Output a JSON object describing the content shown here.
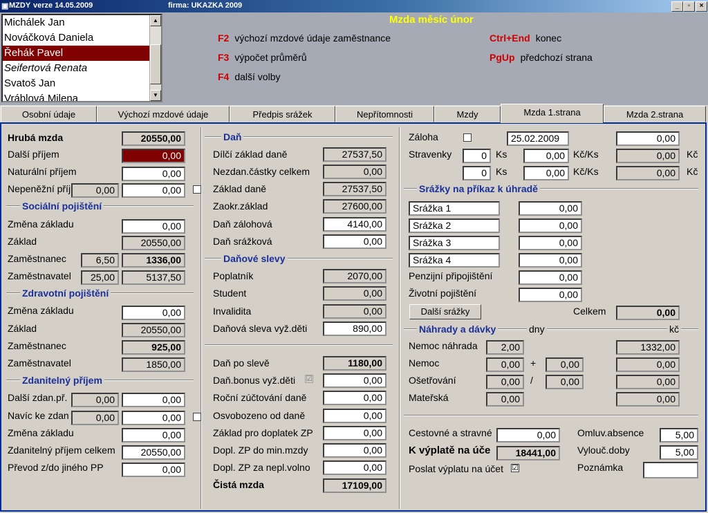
{
  "window": {
    "app": "MZDY",
    "version": "verze 14.05.2009",
    "firm": "firma: UKAZKA 2009",
    "btn_min": "_",
    "btn_max": "▫",
    "btn_close": "×"
  },
  "header": {
    "month": "Mzda měsíc únor",
    "employees": [
      "Michálek Jan",
      "Nováčková Daniela",
      "Řehák Pavel",
      "Seifertová Renata",
      "Svatoš Jan",
      "Vráblová Milena"
    ],
    "hotkeys": [
      {
        "key": "F2",
        "desc": "výchozí mzdové údaje zaměstnance"
      },
      {
        "key": "F3",
        "desc": "výpočet průměrů"
      },
      {
        "key": "F4",
        "desc": "další volby"
      },
      {
        "key": "Ctrl+End",
        "desc": "konec"
      },
      {
        "key": "PgUp",
        "desc": "předchozí strana"
      }
    ]
  },
  "tabs": [
    "Osobní údaje",
    "Výchozí mzdové údaje",
    "Předpis srážek",
    "Nepřítomnosti",
    "Mzdy",
    "Mzda 1.strana",
    "Mzda 2.strana"
  ],
  "col1": {
    "hruba_label": "Hrubá mzda",
    "hruba": "20550,00",
    "dalsi_label": "Další příjem",
    "dalsi": "0,00",
    "natur_label": "Naturální příjem",
    "natur": "0,00",
    "nepenez_label": "Nepeněžní příj",
    "nepenez_a": "0,00",
    "nepenez_b": "0,00",
    "soc_title": "Sociální pojištění",
    "soc_zmena_label": "Změna základu",
    "soc_zmena": "0,00",
    "soc_zaklad_label": "Základ",
    "soc_zaklad": "20550,00",
    "soc_zam_label": "Zaměstnanec",
    "soc_zam_pct": "6,50",
    "soc_zam": "1336,00",
    "soc_zamtel_label": "Zaměstnavatel",
    "soc_zamtel_pct": "25,00",
    "soc_zamtel": "5137,50",
    "zdr_title": "Zdravotní pojištění",
    "zdr_zmena_label": "Změna základu",
    "zdr_zmena": "0,00",
    "zdr_zaklad_label": "Základ",
    "zdr_zaklad": "20550,00",
    "zdr_zam_label": "Zaměstnanec",
    "zdr_zam": "925,00",
    "zdr_zamtel_label": "Zaměstnavatel",
    "zdr_zamtel": "1850,00",
    "zp_title": "Zdanitelný příjem",
    "zp_dalsi_label": "Další zdan.př.",
    "zp_dalsi_a": "0,00",
    "zp_dalsi_b": "0,00",
    "zp_navic_label": "Navíc ke zdan",
    "zp_navic_a": "0,00",
    "zp_navic_b": "0,00",
    "zp_zmena_label": "Změna základu",
    "zp_zmena": "0,00",
    "zp_celkem_label": "Zdanitelný příjem celkem",
    "zp_celkem": "20550,00",
    "zp_prevod_label": "Převod z/do jiného PP",
    "zp_prevod": "0,00"
  },
  "col2": {
    "dan_title": "Daň",
    "dilci_label": "Dílčí základ daně",
    "dilci": "27537,50",
    "nezdan_label": "Nezdan.částky celkem",
    "nezdan": "0,00",
    "zaklad_label": "Základ daně",
    "zaklad": "27537,50",
    "zaokr_label": "Zaokr.základ",
    "zaokr": "27600,00",
    "zaloh_label": "Daň zálohová",
    "zaloh": "4140,00",
    "srazk_label": "Daň srážková",
    "srazk": "0,00",
    "slevy_title": "Daňové slevy",
    "poplatnik_label": "Poplatník",
    "poplatnik": "2070,00",
    "student_label": "Student",
    "student": "0,00",
    "invalid_label": "Invalidita",
    "invalid": "0,00",
    "deti_label": "Daňová sleva vyž.děti",
    "deti": "890,00",
    "poslevy_label": "Daň po slevě",
    "poslevy": "1180,00",
    "bonus_label": "Daň.bonus vyž.děti",
    "bonus_check": "☑",
    "bonus": "0,00",
    "rocni_label": "Roční zúčtování daně",
    "rocni": "0,00",
    "osvob_label": "Osvobozeno od daně",
    "osvob": "0,00",
    "zakzp_label": "Základ pro doplatek ZP",
    "zakzp": "0,00",
    "doplmin_label": "Dopl. ZP do min.mzdy",
    "doplmin": "0,00",
    "doplnepl_label": "Dopl. ZP za nepl.volno",
    "doplnepl": "0,00",
    "cista_label": "Čistá mzda",
    "cista": "17109,00"
  },
  "col3": {
    "zaloha_label": "Záloha",
    "zaloha_date": "25.02.2009",
    "zaloha": "0,00",
    "strav_label": "Stravenky",
    "ks_label": "Ks",
    "kcks_label": "Kč/Ks",
    "kc_label": "Kč",
    "strav1_ks": "0",
    "strav1_kcks": "0,00",
    "strav1_kc": "0,00",
    "strav2_ks": "0",
    "strav2_kcks": "0,00",
    "strav2_kc": "0,00",
    "srazky_title": "Srážky na příkaz k úhradě",
    "srazky": [
      {
        "name": "Srážka 1",
        "value": "0,00"
      },
      {
        "name": "Srážka 2",
        "value": "0,00"
      },
      {
        "name": "Srážka 3",
        "value": "0,00"
      },
      {
        "name": "Srážka 4",
        "value": "0,00"
      }
    ],
    "penz_label": "Penzijní připojištění",
    "penz": "0,00",
    "ziv_label": "Životní pojištění",
    "ziv": "0,00",
    "dalsi_srazky_btn": "Další srážky",
    "celkem_label": "Celkem",
    "celkem": "0,00",
    "nahrady_title": "Náhrady a dávky",
    "dny_label": "dny",
    "kc_small": "kč",
    "nemoc_nahr_label": "Nemoc náhrada",
    "nemoc_nahr_dny": "2,00",
    "nemoc_nahr_kc": "1332,00",
    "nemoc_label": "Nemoc",
    "nemoc_dny": "0,00",
    "nemoc_plus": "+",
    "nemoc_dny2": "0,00",
    "nemoc_kc": "0,00",
    "oset_label": "Ošetřování",
    "oset_dny": "0,00",
    "oset_slash": "/",
    "oset_dny2": "0,00",
    "oset_kc": "0,00",
    "mater_label": "Mateřská",
    "mater_dny": "0,00",
    "mater_kc": "0,00",
    "cest_label": "Cestovné a stravné",
    "cest": "0,00",
    "vyplata_label": "K výplatě na úče",
    "vyplata": "18441,00",
    "poslat_label": "Poslat výplatu na účet",
    "poslat_check": "☑",
    "omluv_label": "Omluv.absence",
    "omluv": "5,00",
    "vylouc_label": "Vylouč.doby",
    "vylouc": "5,00",
    "pozn_label": "Poznámka",
    "pozn": ""
  }
}
